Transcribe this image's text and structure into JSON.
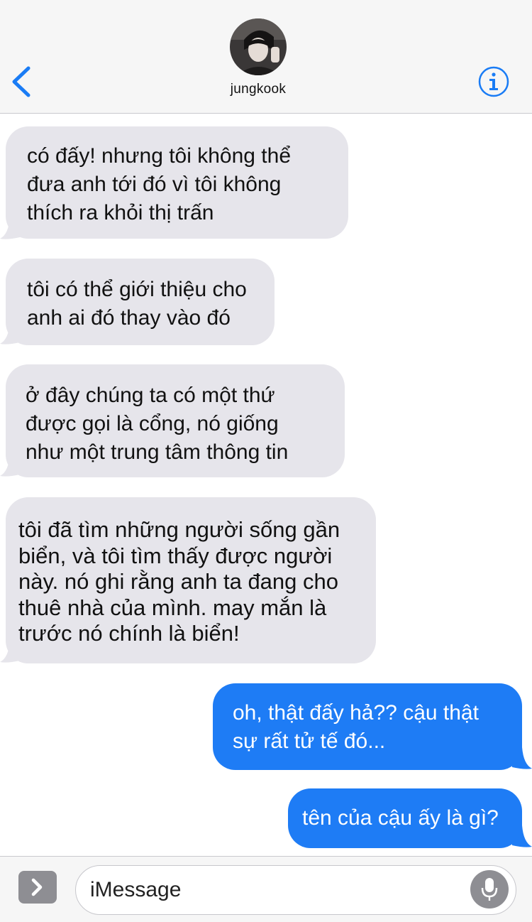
{
  "header": {
    "contact_name": "jungkook",
    "back_icon": "chevron-left-icon",
    "info_icon": "info-icon",
    "accent_color": "#1a7cf5"
  },
  "messages": [
    {
      "direction": "incoming",
      "text": "có đấy! nhưng tôi không thể\nđưa anh tới đó vì tôi không\nthích ra khỏi thị trấn"
    },
    {
      "direction": "incoming",
      "text": "tôi có thể giới thiệu cho\nanh ai đó thay vào đó"
    },
    {
      "direction": "incoming",
      "text": "ở đây chúng ta có một thứ\nđược gọi là cổng, nó giống\nnhư một trung tâm thông tin"
    },
    {
      "direction": "incoming",
      "text": "tôi đã tìm những người sống gần\nbiển, và tôi tìm thấy được người\nnày. nó ghi rằng anh ta đang cho\nthuê nhà của mình. may mắn là\ntrước nó chính là biển!"
    },
    {
      "direction": "outgoing",
      "text": "oh, thật đấy hả?? cậu thật\nsự rất tử tế đó..."
    },
    {
      "direction": "outgoing",
      "text": "tên của cậu ấy là gì?"
    }
  ],
  "composer": {
    "placeholder": "iMessage",
    "apps_icon": "chevron-right-icon",
    "mic_icon": "microphone-icon"
  },
  "colors": {
    "incoming_bubble": "#e6e5eb",
    "outgoing_bubble": "#1e7cf5"
  }
}
